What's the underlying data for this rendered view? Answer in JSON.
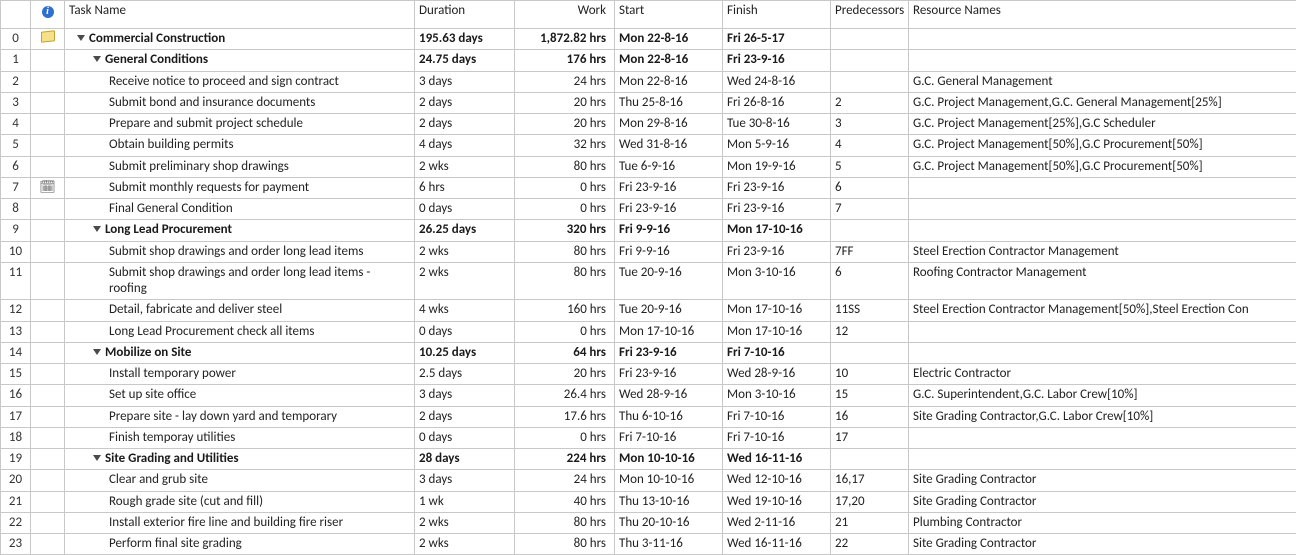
{
  "columns": {
    "rownum": "",
    "info": "i",
    "task": "Task Name",
    "duration": "Duration",
    "work": "Work",
    "start": "Start",
    "finish": "Finish",
    "preds": "Predecessors",
    "resources": "Resource Names"
  },
  "rows": [
    {
      "n": "0",
      "icon": "note",
      "indent": 0,
      "tri": true,
      "bold": true,
      "name": "Commercial Construction",
      "dur": "195.63 days",
      "work": "1,872.82 hrs",
      "start": "Mon 22-8-16",
      "finish": "Fri 26-5-17",
      "pred": "",
      "res": ""
    },
    {
      "n": "1",
      "icon": "",
      "indent": 1,
      "tri": true,
      "bold": true,
      "name": "General Conditions",
      "dur": "24.75 days",
      "work": "176 hrs",
      "start": "Mon 22-8-16",
      "finish": "Fri 23-9-16",
      "pred": "",
      "res": ""
    },
    {
      "n": "2",
      "icon": "",
      "indent": 2,
      "tri": false,
      "bold": false,
      "name": "Receive notice to proceed and sign contract",
      "dur": "3 days",
      "work": "24 hrs",
      "start": "Mon 22-8-16",
      "finish": "Wed 24-8-16",
      "pred": "",
      "res": "G.C. General Management"
    },
    {
      "n": "3",
      "icon": "",
      "indent": 2,
      "tri": false,
      "bold": false,
      "name": "Submit bond and insurance documents",
      "dur": "2 days",
      "work": "20 hrs",
      "start": "Thu 25-8-16",
      "finish": "Fri 26-8-16",
      "pred": "2",
      "res": "G.C. Project Management,G.C. General Management[25%]"
    },
    {
      "n": "4",
      "icon": "",
      "indent": 2,
      "tri": false,
      "bold": false,
      "name": "Prepare and submit project schedule",
      "dur": "2 days",
      "work": "20 hrs",
      "start": "Mon 29-8-16",
      "finish": "Tue 30-8-16",
      "pred": "3",
      "res": "G.C. Project Management[25%],G.C Scheduler"
    },
    {
      "n": "5",
      "icon": "",
      "indent": 2,
      "tri": false,
      "bold": false,
      "name": "Obtain building permits",
      "dur": "4 days",
      "work": "32 hrs",
      "start": "Wed 31-8-16",
      "finish": "Mon 5-9-16",
      "pred": "4",
      "res": "G.C. Project Management[50%],G.C Procurement[50%]"
    },
    {
      "n": "6",
      "icon": "",
      "indent": 2,
      "tri": false,
      "bold": false,
      "name": "Submit preliminary shop drawings",
      "dur": "2 wks",
      "work": "80 hrs",
      "start": "Tue 6-9-16",
      "finish": "Mon 19-9-16",
      "pred": "5",
      "res": "G.C. Project Management[50%],G.C Procurement[50%]"
    },
    {
      "n": "7",
      "icon": "recur",
      "indent": 2,
      "tri": false,
      "bold": false,
      "name": "Submit monthly requests for payment",
      "dur": "6 hrs",
      "work": "0 hrs",
      "start": "Fri 23-9-16",
      "finish": "Fri 23-9-16",
      "pred": "6",
      "res": ""
    },
    {
      "n": "8",
      "icon": "",
      "indent": 2,
      "tri": false,
      "bold": false,
      "name": "Final General Condition",
      "dur": "0 days",
      "work": "0 hrs",
      "start": "Fri 23-9-16",
      "finish": "Fri 23-9-16",
      "pred": "7",
      "res": ""
    },
    {
      "n": "9",
      "icon": "",
      "indent": 1,
      "tri": true,
      "bold": true,
      "name": "Long Lead Procurement",
      "dur": "26.25 days",
      "work": "320 hrs",
      "start": "Fri 9-9-16",
      "finish": "Mon 17-10-16",
      "pred": "",
      "res": ""
    },
    {
      "n": "10",
      "icon": "",
      "indent": 2,
      "tri": false,
      "bold": false,
      "name": "Submit shop drawings and order long lead items",
      "dur": "2 wks",
      "work": "80 hrs",
      "start": "Fri 9-9-16",
      "finish": "Fri 23-9-16",
      "pred": "7FF",
      "res": "Steel Erection Contractor Management"
    },
    {
      "n": "11",
      "icon": "",
      "indent": 2,
      "tri": false,
      "bold": false,
      "name": "Submit shop drawings and order long lead items - roofing",
      "dur": "2 wks",
      "work": "80 hrs",
      "start": "Tue 20-9-16",
      "finish": "Mon 3-10-16",
      "pred": "6",
      "res": "Roofing Contractor Management"
    },
    {
      "n": "12",
      "icon": "",
      "indent": 2,
      "tri": false,
      "bold": false,
      "name": "Detail, fabricate and deliver steel",
      "dur": "4 wks",
      "work": "160 hrs",
      "start": "Tue 20-9-16",
      "finish": "Mon 17-10-16",
      "pred": "11SS",
      "res": "Steel Erection Contractor Management[50%],Steel Erection Con"
    },
    {
      "n": "13",
      "icon": "",
      "indent": 2,
      "tri": false,
      "bold": false,
      "name": "Long Lead Procurement check all items",
      "dur": "0 days",
      "work": "0 hrs",
      "start": "Mon 17-10-16",
      "finish": "Mon 17-10-16",
      "pred": "12",
      "res": ""
    },
    {
      "n": "14",
      "icon": "",
      "indent": 1,
      "tri": true,
      "bold": true,
      "name": "Mobilize on Site",
      "dur": "10.25 days",
      "work": "64 hrs",
      "start": "Fri 23-9-16",
      "finish": "Fri 7-10-16",
      "pred": "",
      "res": ""
    },
    {
      "n": "15",
      "icon": "",
      "indent": 2,
      "tri": false,
      "bold": false,
      "name": "Install temporary power",
      "dur": "2.5 days",
      "work": "20 hrs",
      "start": "Fri 23-9-16",
      "finish": "Wed 28-9-16",
      "pred": "10",
      "res": "Electric Contractor"
    },
    {
      "n": "16",
      "icon": "",
      "indent": 2,
      "tri": false,
      "bold": false,
      "name": "Set up site office",
      "dur": "3 days",
      "work": "26.4 hrs",
      "start": "Wed 28-9-16",
      "finish": "Mon 3-10-16",
      "pred": "15",
      "res": "G.C. Superintendent,G.C. Labor Crew[10%]"
    },
    {
      "n": "17",
      "icon": "",
      "indent": 2,
      "tri": false,
      "bold": false,
      "name": "Prepare site - lay down yard and temporary",
      "dur": "2 days",
      "work": "17.6 hrs",
      "start": "Thu 6-10-16",
      "finish": "Fri 7-10-16",
      "pred": "16",
      "res": "Site Grading Contractor,G.C. Labor Crew[10%]"
    },
    {
      "n": "18",
      "icon": "",
      "indent": 2,
      "tri": false,
      "bold": false,
      "name": "Finish temporay utilities",
      "dur": "0 days",
      "work": "0 hrs",
      "start": "Fri 7-10-16",
      "finish": "Fri 7-10-16",
      "pred": "17",
      "res": ""
    },
    {
      "n": "19",
      "icon": "",
      "indent": 1,
      "tri": true,
      "bold": true,
      "name": "Site Grading and Utilities",
      "dur": "28 days",
      "work": "224 hrs",
      "start": "Mon 10-10-16",
      "finish": "Wed 16-11-16",
      "pred": "",
      "res": ""
    },
    {
      "n": "20",
      "icon": "",
      "indent": 2,
      "tri": false,
      "bold": false,
      "name": "Clear and grub site",
      "dur": "3 days",
      "work": "24 hrs",
      "start": "Mon 10-10-16",
      "finish": "Wed 12-10-16",
      "pred": "16,17",
      "res": "Site Grading Contractor"
    },
    {
      "n": "21",
      "icon": "",
      "indent": 2,
      "tri": false,
      "bold": false,
      "name": "Rough grade site (cut and fill)",
      "dur": "1 wk",
      "work": "40 hrs",
      "start": "Thu 13-10-16",
      "finish": "Wed 19-10-16",
      "pred": "17,20",
      "res": "Site Grading Contractor"
    },
    {
      "n": "22",
      "icon": "",
      "indent": 2,
      "tri": false,
      "bold": false,
      "name": "Install exterior fire line and building fire riser",
      "dur": "2 wks",
      "work": "80 hrs",
      "start": "Thu 20-10-16",
      "finish": "Wed 2-11-16",
      "pred": "21",
      "res": "Plumbing Contractor"
    },
    {
      "n": "23",
      "icon": "",
      "indent": 2,
      "tri": false,
      "bold": false,
      "name": "Perform final site grading",
      "dur": "2 wks",
      "work": "80 hrs",
      "start": "Thu 3-11-16",
      "finish": "Wed 16-11-16",
      "pred": "22",
      "res": "Site Grading Contractor"
    }
  ]
}
